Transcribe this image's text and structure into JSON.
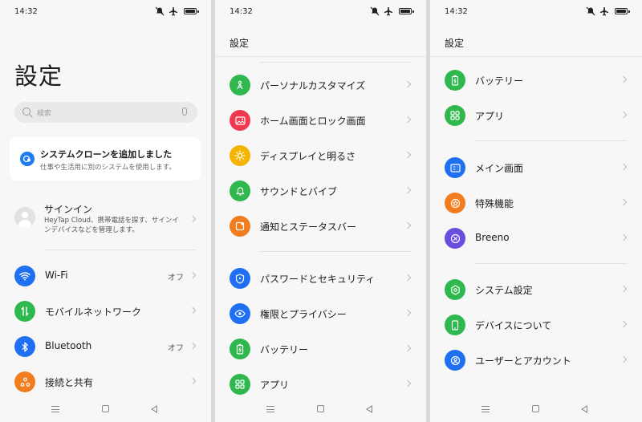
{
  "status": {
    "time": "14:32"
  },
  "panel1": {
    "title": "設定",
    "search_placeholder": "検索",
    "card": {
      "title": "システムクローンを追加しました",
      "subtitle": "仕事や生活用に別のシステムを使用します。"
    },
    "signin": {
      "title": "サインイン",
      "subtitle": "HeyTap Cloud、携帯電話を探す、サインインデバイスなどを管理します。"
    },
    "items": [
      {
        "label": "Wi-Fi",
        "value": "オフ",
        "icon": "wifi-icon",
        "color": "#1e6ff2"
      },
      {
        "label": "モバイルネットワーク",
        "value": "",
        "icon": "mobile-network-icon",
        "color": "#2fb84d"
      },
      {
        "label": "Bluetooth",
        "value": "オフ",
        "icon": "bluetooth-icon",
        "color": "#1e6ff2"
      },
      {
        "label": "接続と共有",
        "value": "",
        "icon": "share-icon",
        "color": "#f27d1e"
      }
    ]
  },
  "panel2": {
    "header": "設定",
    "items": [
      {
        "label": "パーソナルカスタマイズ",
        "icon": "customize-icon",
        "color": "#2fb84d"
      },
      {
        "label": "ホーム画面とロック画面",
        "icon": "wallpaper-icon",
        "color": "#f0384f"
      },
      {
        "label": "ディスプレイと明るさ",
        "icon": "brightness-icon",
        "color": "#f5b400"
      },
      {
        "label": "サウンドとバイブ",
        "icon": "bell-icon",
        "color": "#2fb84d"
      },
      {
        "label": "通知とステータスバー",
        "icon": "notification-icon",
        "color": "#f27d1e"
      },
      {
        "label": "パスワードとセキュリティ",
        "icon": "shield-icon",
        "color": "#1e6ff2"
      },
      {
        "label": "権限とプライバシー",
        "icon": "privacy-icon",
        "color": "#1e6ff2"
      },
      {
        "label": "バッテリー",
        "icon": "battery-icon",
        "color": "#2fb84d"
      },
      {
        "label": "アプリ",
        "icon": "apps-icon",
        "color": "#2fb84d"
      }
    ]
  },
  "panel3": {
    "header": "設定",
    "items": [
      {
        "label": "バッテリー",
        "icon": "battery-icon",
        "color": "#2fb84d"
      },
      {
        "label": "アプリ",
        "icon": "apps-icon",
        "color": "#2fb84d"
      },
      {
        "label": "メイン画面",
        "icon": "main-screen-icon",
        "color": "#1e6ff2"
      },
      {
        "label": "特殊機能",
        "icon": "special-features-icon",
        "color": "#f27d1e"
      },
      {
        "label": "Breeno",
        "icon": "breeno-icon",
        "color": "#6a4ee0"
      },
      {
        "label": "システム設定",
        "icon": "system-settings-icon",
        "color": "#2fb84d"
      },
      {
        "label": "デバイスについて",
        "icon": "device-icon",
        "color": "#2fb84d"
      },
      {
        "label": "ユーザーとアカウント",
        "icon": "user-icon",
        "color": "#1e6ff2"
      }
    ]
  }
}
